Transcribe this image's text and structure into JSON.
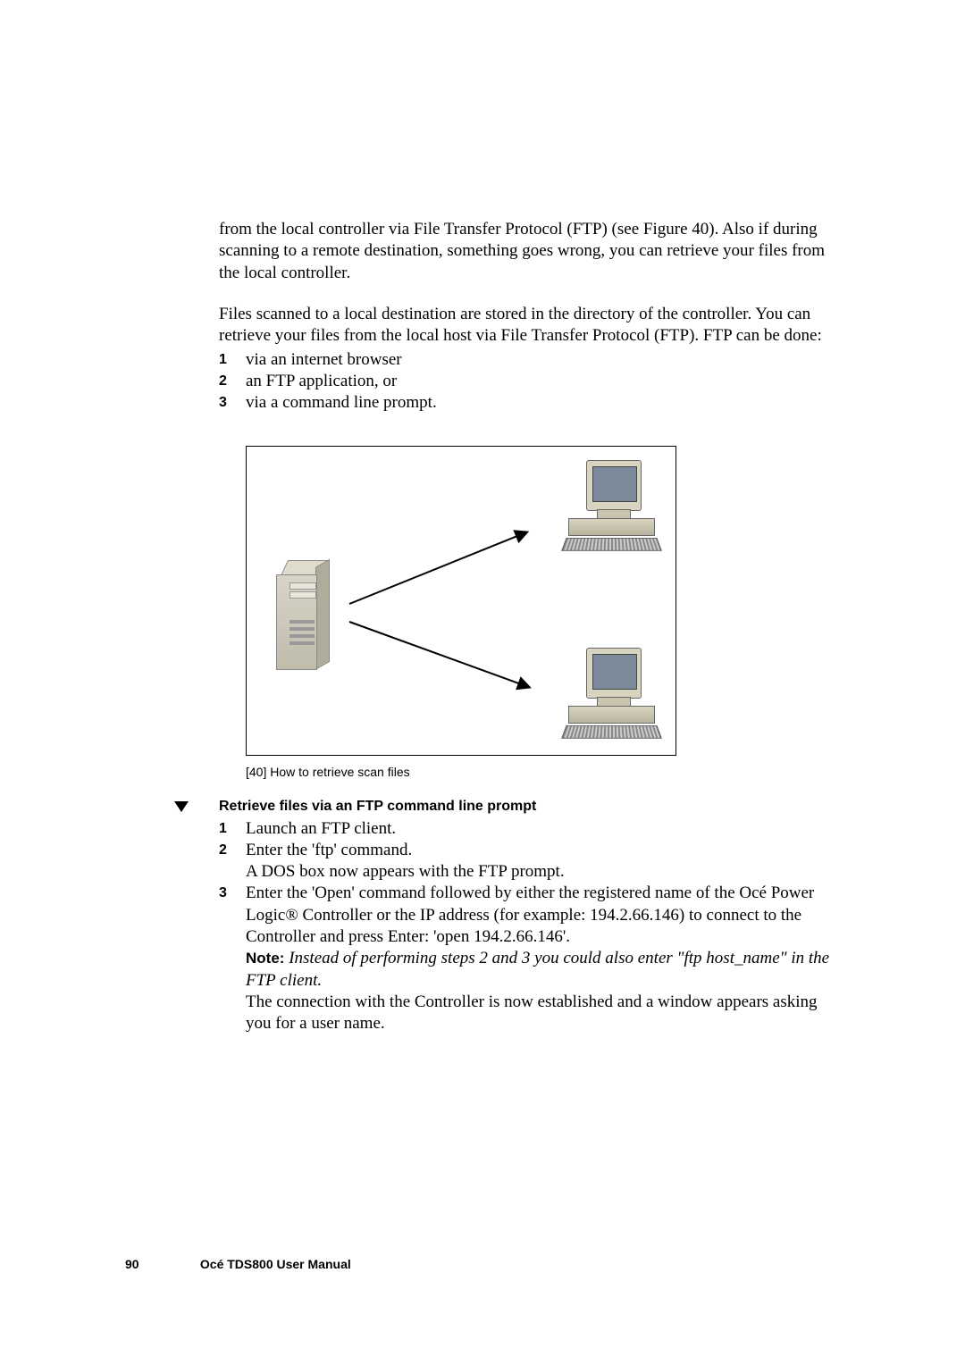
{
  "para1": "from the local controller via File Transfer Protocol (FTP) (see Figure 40). Also if during scanning to a remote destination, something goes wrong, you can retrieve your files from the local controller.",
  "para2": "Files scanned to a local destination are stored in the directory of the controller. You can retrieve your files from the local host via File Transfer Protocol (FTP). FTP can be done:",
  "listA": {
    "n1": "1",
    "t1": "via an internet browser",
    "n2": "2",
    "t2": "an FTP application, or",
    "n3": "3",
    "t3": "via a command line prompt."
  },
  "figure_caption": "[40] How to retrieve scan files",
  "procedure_title": "Retrieve files via an FTP command line prompt",
  "listB": {
    "n1": "1",
    "t1": "Launch an FTP client.",
    "n2": "2",
    "t2a": "Enter the 'ftp' command.",
    "t2b": "A DOS box now appears with the FTP prompt.",
    "n3": "3",
    "t3a": "Enter the 'Open' command followed by either the registered name of the Océ Power Logic® Controller or the IP address (for example: 194.2.66.146) to connect to the Controller and press Enter: 'open 194.2.66.146'.",
    "note_label": "Note:",
    "note_text": " Instead of performing steps 2 and 3 you could also enter \"ftp host_name\" in the FTP client.",
    "t3b": "The connection with the Controller is now established and a window appears asking you for a user name."
  },
  "footer": {
    "page": "90",
    "title": "Océ TDS800 User Manual"
  }
}
